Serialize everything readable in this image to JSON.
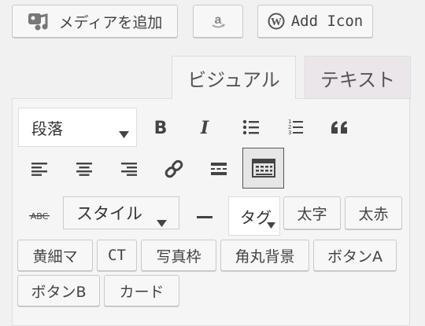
{
  "top_buttons": {
    "add_media": "メディアを追加",
    "add_icon": "Add Icon"
  },
  "tabs": {
    "visual": "ビジュアル",
    "text": "テキスト"
  },
  "toolbar": {
    "format_select": "段落",
    "style_select": "スタイル",
    "tag_select": "タグ"
  },
  "quicktags": {
    "row1": [
      "太字",
      "太赤"
    ],
    "row2": [
      "黄細マ",
      "CT",
      "写真枠",
      "角丸背景",
      "ボタンA"
    ],
    "row3": [
      "ボタンB",
      "カード"
    ]
  },
  "colors": {
    "background": "#f1f1f1",
    "panel": "#f5f5f5",
    "text_tab": "#ebe6ea",
    "button_bg": "#f7f7f7",
    "icon": "#444444"
  },
  "icons": [
    "media-icon",
    "amazon-icon",
    "wordpress-icon",
    "bold-icon",
    "italic-icon",
    "bullet-list-icon",
    "numbered-list-icon",
    "blockquote-icon",
    "align-left-icon",
    "align-center-icon",
    "align-right-icon",
    "link-icon",
    "read-more-icon",
    "toolbar-toggle-icon",
    "strikethrough-icon",
    "horizontal-rule-icon",
    "dropdown-arrow-icon"
  ]
}
